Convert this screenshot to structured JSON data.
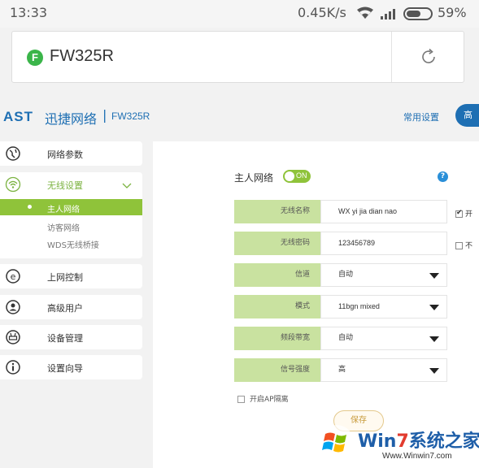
{
  "status_bar": {
    "time": "13:33",
    "net_speed": "0.45K/s",
    "battery": "59%"
  },
  "browser": {
    "favicon_letter": "F",
    "url_title": "FW325R",
    "icons": [
      "refresh-icon"
    ]
  },
  "router_header": {
    "logo": "AST",
    "brand": "迅捷网络",
    "separator": "|",
    "model": "FW325R",
    "common_settings": "常用设置",
    "advanced_tab": "高"
  },
  "sidebar": {
    "network_params": "网络参数",
    "wireless_settings": "无线设置",
    "sub_main_network": "主人网络",
    "sub_guest_network": "访客网络",
    "sub_wds": "WDS无线桥接",
    "internet_control": "上网控制",
    "advanced_user": "高级用户",
    "device_management": "设备管理",
    "setup_wizard": "设置向导"
  },
  "main": {
    "title": "主人网络",
    "toggle_label": "ON",
    "help_label": "?",
    "fields": [
      {
        "label": "无线名称",
        "value": "WX yi jia dian nao"
      },
      {
        "label": "无线密码",
        "value": "123456789"
      },
      {
        "label": "信道",
        "value": "自动"
      },
      {
        "label": "模式",
        "value": "11bgn mixed"
      },
      {
        "label": "频段带宽",
        "value": "自动"
      },
      {
        "label": "信号强度",
        "value": "高"
      }
    ],
    "ssid_side_check": "开",
    "password_side_check": "不",
    "ap_isolation": "开启AP隔离",
    "save_button": "保存"
  },
  "watermark": {
    "title_prefix": "Win",
    "title_number": "7",
    "title_suffix": "系统之家",
    "url": "Www.Winwin7.com"
  },
  "colors": {
    "accent_green": "#8fc33a",
    "label_green": "#c9e2a0",
    "brand_blue": "#1e6fb3"
  }
}
